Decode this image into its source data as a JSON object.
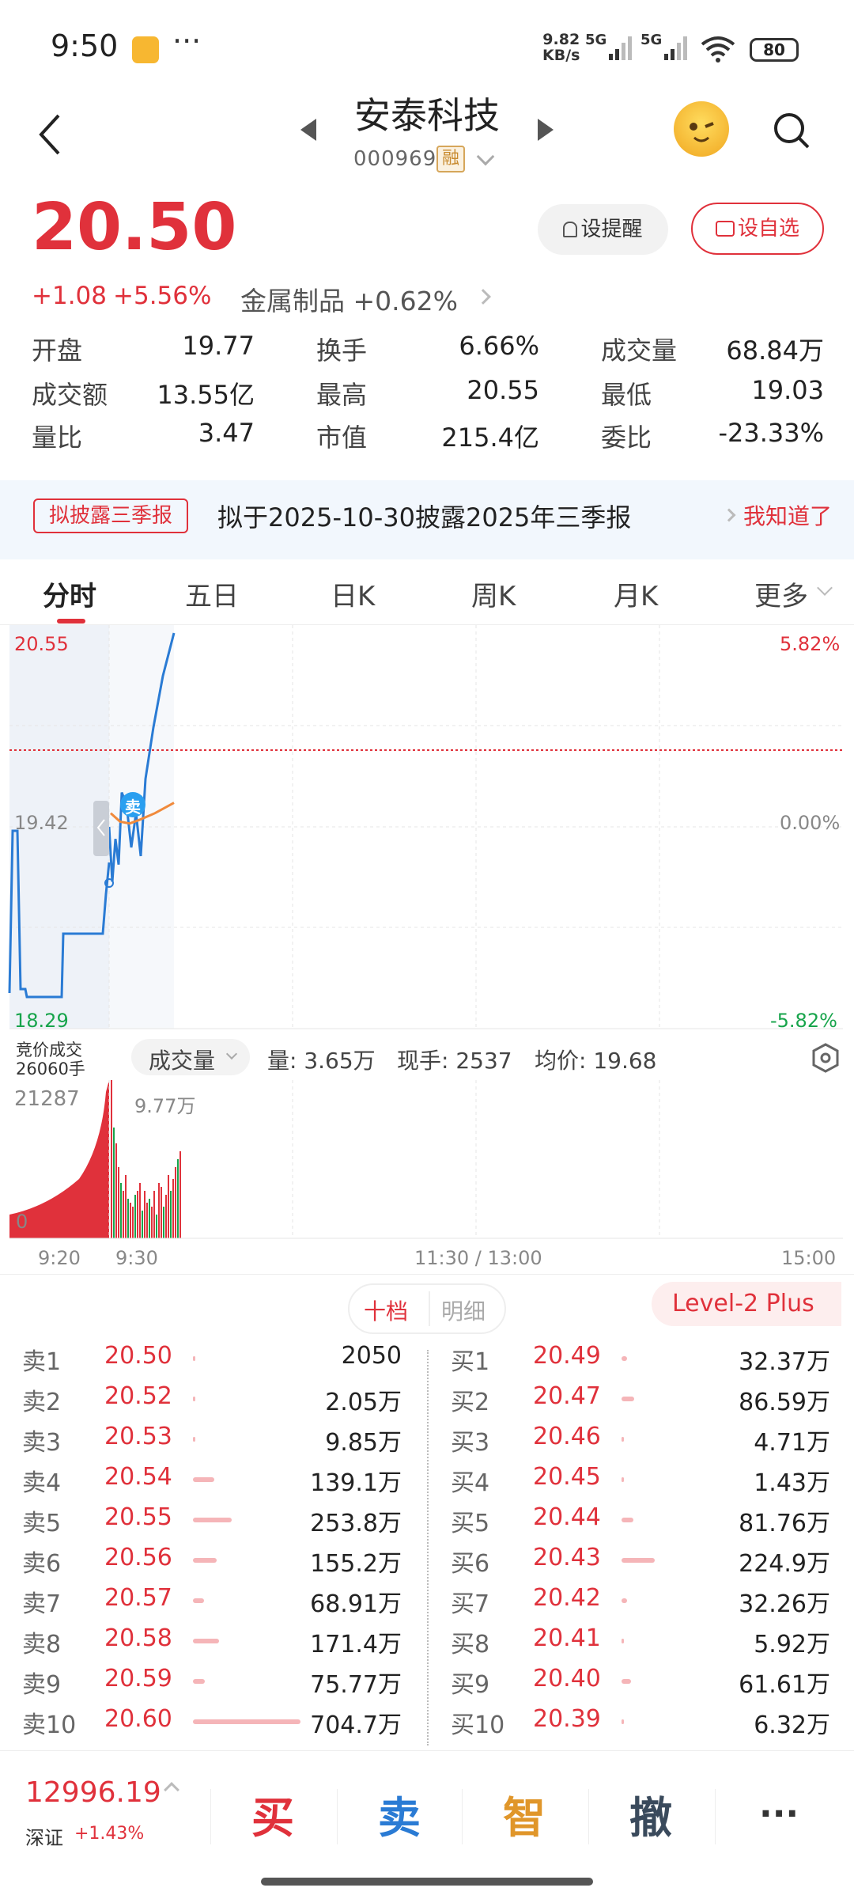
{
  "status_bar": {
    "time": "9:50",
    "dots": "···",
    "speed_line1": "9.82",
    "speed_line2": "KB/s",
    "sig1": "5G",
    "sig2": "5G",
    "battery": "80"
  },
  "header": {
    "title": "安泰科技",
    "code": "000969",
    "margin_badge": "融"
  },
  "quote": {
    "price": "20.50",
    "change": "+1.08",
    "change_pct": "+5.56%",
    "sector_name": "金属制品",
    "sector_pct": "+0.62%",
    "remind_label": "设提醒",
    "fav_label": "设自选"
  },
  "stats": [
    {
      "label": "开盘",
      "value": "19.77",
      "color": "red"
    },
    {
      "label": "换手",
      "value": "6.66%",
      "color": "normal"
    },
    {
      "label": "成交量",
      "value": "68.84万",
      "color": "normal"
    },
    {
      "label": "成交额",
      "value": "13.55亿",
      "color": "normal"
    },
    {
      "label": "最高",
      "value": "20.55",
      "color": "red"
    },
    {
      "label": "最低",
      "value": "19.03",
      "color": "green"
    },
    {
      "label": "量比",
      "value": "3.47",
      "color": "normal"
    },
    {
      "label": "市值",
      "value": "215.4亿",
      "color": "normal"
    },
    {
      "label": "委比",
      "value": "-23.33%",
      "color": "green"
    }
  ],
  "notice": {
    "tag": "拟披露三季报",
    "text": "拟于2025-10-30披露2025年三季报",
    "ok": "我知道了"
  },
  "tabs": [
    "分时",
    "五日",
    "日K",
    "周K",
    "月K",
    "更多"
  ],
  "chart": {
    "y_top": "20.55",
    "y_mid": "19.42",
    "y_bot": "18.29",
    "pct_top": "5.82%",
    "pct_mid": "0.00%",
    "pct_bot": "-5.82%",
    "auction_line1": "竞价成交",
    "auction_line2": "26060手",
    "vol_selector": "成交量",
    "vol_amount": "量: 3.65万",
    "vol_now": "现手: 2537",
    "vol_avg": "均价: 19.68",
    "vol_left_max": "21287",
    "vol_left_min": "0",
    "vol_right_max": "9.77万",
    "x_labels": [
      "9:20",
      "9:30",
      "11:30 / 13:00",
      "15:00"
    ],
    "sell_marker": "卖"
  },
  "chart_data": {
    "type": "line",
    "title": "",
    "y_range": [
      18.29,
      20.55
    ],
    "pct_range": [
      -5.82,
      5.82
    ],
    "prev_close": 19.42,
    "price_series_morning": [
      19.42,
      19.1,
      19.35,
      19.2,
      19.62,
      19.55,
      19.3,
      19.5,
      19.25,
      19.7,
      20.0,
      20.3,
      20.55
    ],
    "avg_series_morning": [
      19.5,
      19.45,
      19.44,
      19.46,
      19.5,
      19.56
    ]
  },
  "orderbook": {
    "toggle_a": "十档",
    "toggle_b": "明细",
    "level2": "Level-2 Plus",
    "sells": [
      {
        "label": "卖1",
        "price": "20.50",
        "vol": "2050",
        "bar": 0.0
      },
      {
        "label": "卖2",
        "price": "20.52",
        "vol": "2.05万",
        "bar": 0.01
      },
      {
        "label": "卖3",
        "price": "20.53",
        "vol": "9.85万",
        "bar": 0.02
      },
      {
        "label": "卖4",
        "price": "20.54",
        "vol": "139.1万",
        "bar": 0.2
      },
      {
        "label": "卖5",
        "price": "20.55",
        "vol": "253.8万",
        "bar": 0.36
      },
      {
        "label": "卖6",
        "price": "20.56",
        "vol": "155.2万",
        "bar": 0.22
      },
      {
        "label": "卖7",
        "price": "20.57",
        "vol": "68.91万",
        "bar": 0.1
      },
      {
        "label": "卖8",
        "price": "20.58",
        "vol": "171.4万",
        "bar": 0.24
      },
      {
        "label": "卖9",
        "price": "20.59",
        "vol": "75.77万",
        "bar": 0.11
      },
      {
        "label": "卖10",
        "price": "20.60",
        "vol": "704.7万",
        "bar": 1.0
      }
    ],
    "buys": [
      {
        "label": "买1",
        "price": "20.49",
        "vol": "32.37万",
        "bar": 0.05
      },
      {
        "label": "买2",
        "price": "20.47",
        "vol": "86.59万",
        "bar": 0.12
      },
      {
        "label": "买3",
        "price": "20.46",
        "vol": "4.71万",
        "bar": 0.01
      },
      {
        "label": "买4",
        "price": "20.45",
        "vol": "1.43万",
        "bar": 0.005
      },
      {
        "label": "买5",
        "price": "20.44",
        "vol": "81.76万",
        "bar": 0.11
      },
      {
        "label": "买6",
        "price": "20.43",
        "vol": "224.9万",
        "bar": 0.31
      },
      {
        "label": "买7",
        "price": "20.42",
        "vol": "32.26万",
        "bar": 0.05
      },
      {
        "label": "买8",
        "price": "20.41",
        "vol": "5.92万",
        "bar": 0.01
      },
      {
        "label": "买9",
        "price": "20.40",
        "vol": "61.61万",
        "bar": 0.09
      },
      {
        "label": "买10",
        "price": "20.39",
        "vol": "6.32万",
        "bar": 0.01
      }
    ]
  },
  "bottom": {
    "index_value": "12996.19",
    "index_name": "深证",
    "index_pct": "+1.43%",
    "buy": "买",
    "sell": "卖",
    "smart": "智",
    "cancel": "撤",
    "more": "···"
  },
  "colors": {
    "up": "#e0313b",
    "down": "#17a44b",
    "line": "#2a7bd4",
    "avg": "#f08a3c"
  }
}
